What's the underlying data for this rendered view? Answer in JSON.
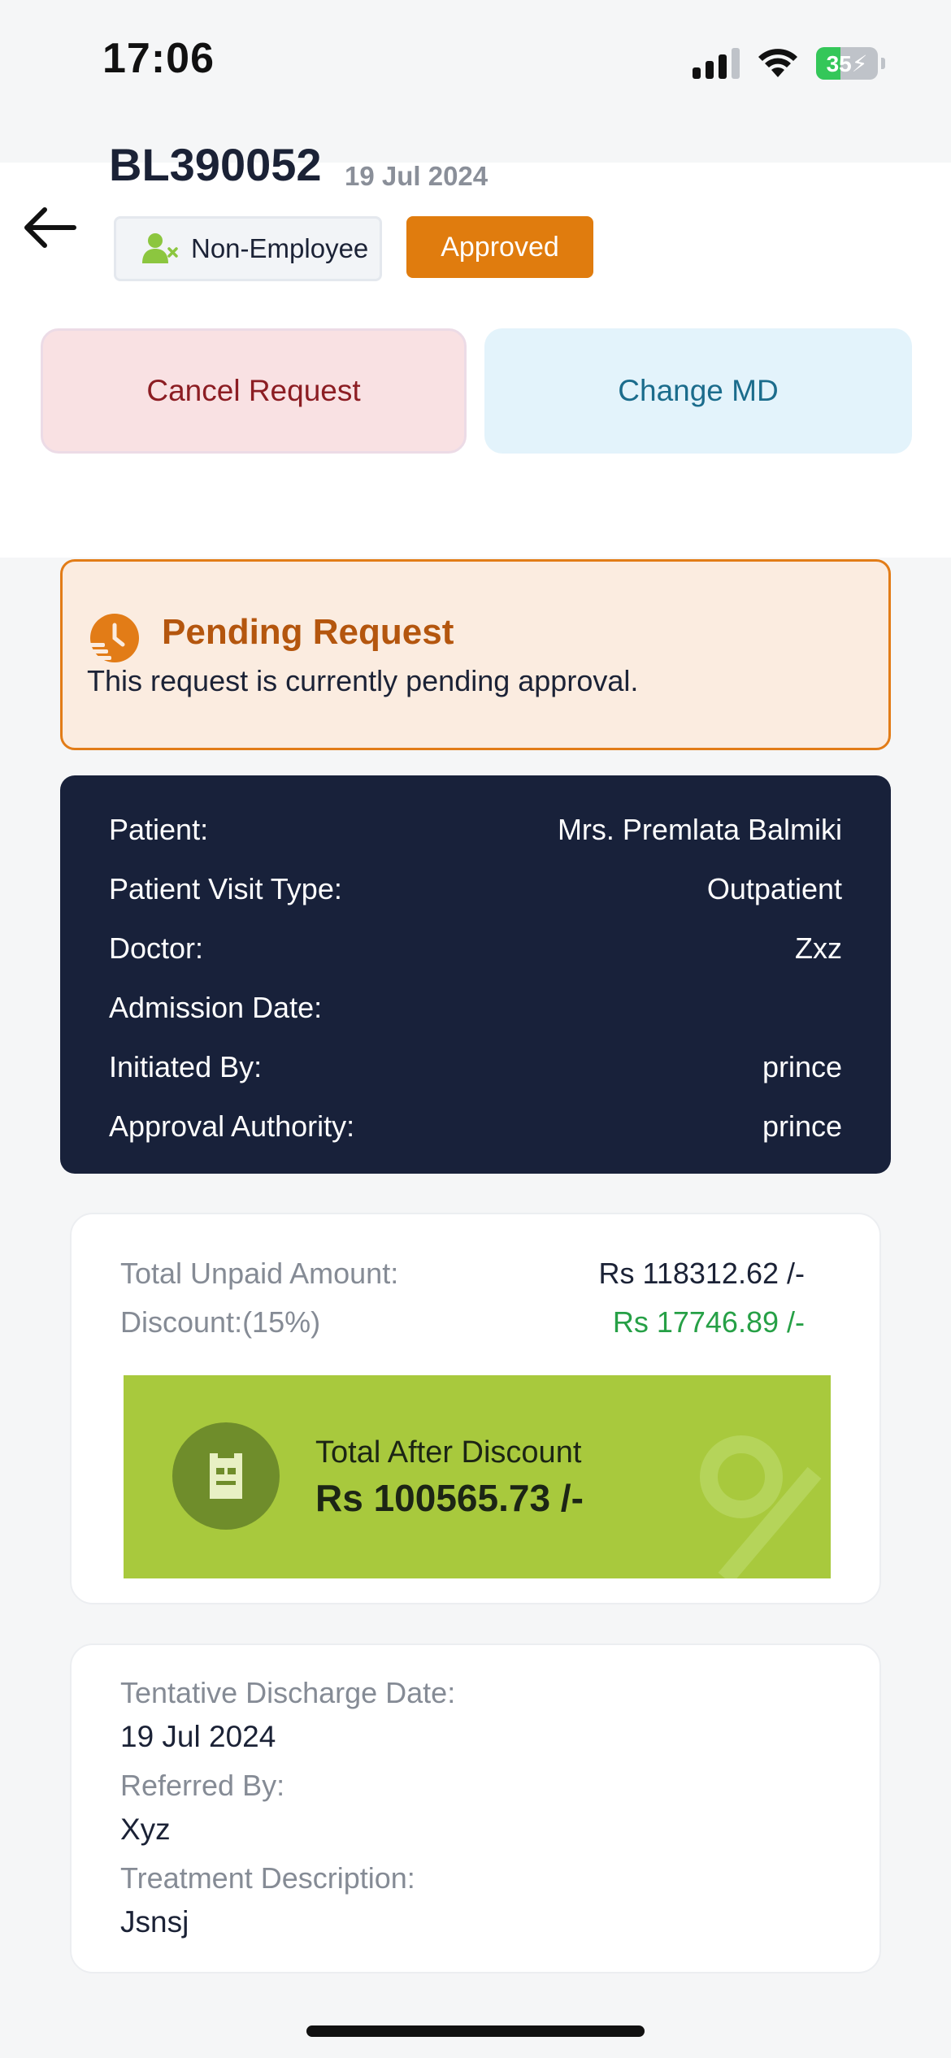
{
  "status_bar": {
    "time": "17:06",
    "battery": "35",
    "icons": [
      "signal-icon",
      "wifi-icon",
      "battery-charging-icon"
    ]
  },
  "header": {
    "bill_no": "BL390052",
    "date": "19 Jul 2024",
    "employee_chip": "Non-Employee",
    "status_chip": "Approved",
    "cancel_label": "Cancel Request",
    "change_label": "Change MD"
  },
  "pending": {
    "title": "Pending Request",
    "text": "This request is currently pending approval."
  },
  "info": {
    "rows": [
      {
        "label": "Patient:",
        "value": "Mrs. Premlata Balmiki"
      },
      {
        "label": "Patient Visit Type:",
        "value": "Outpatient"
      },
      {
        "label": "Doctor:",
        "value": "Zxz"
      },
      {
        "label": "Admission Date:",
        "value": ""
      },
      {
        "label": "Initiated By:",
        "value": "prince"
      },
      {
        "label": "Approval Authority:",
        "value": "prince"
      }
    ]
  },
  "amount": {
    "unpaid_label": "Total Unpaid Amount:",
    "unpaid_value": "Rs 118312.62 /-",
    "discount_label": "Discount:(15%)",
    "discount_value": "Rs 17746.89 /-",
    "total_label": "Total After Discount",
    "total_value": "Rs 100565.73 /-"
  },
  "details": {
    "discharge_label": "Tentative Discharge Date:",
    "discharge_value": "19 Jul 2024",
    "referred_label": "Referred By:",
    "referred_value": "Xyz",
    "treatment_label": "Treatment Description:",
    "treatment_value": "Jsnsj"
  },
  "colors": {
    "accent_orange": "#e07c0e",
    "dark_card": "#18213a",
    "green_total": "#a8c93d",
    "discount_green": "#26a046"
  }
}
